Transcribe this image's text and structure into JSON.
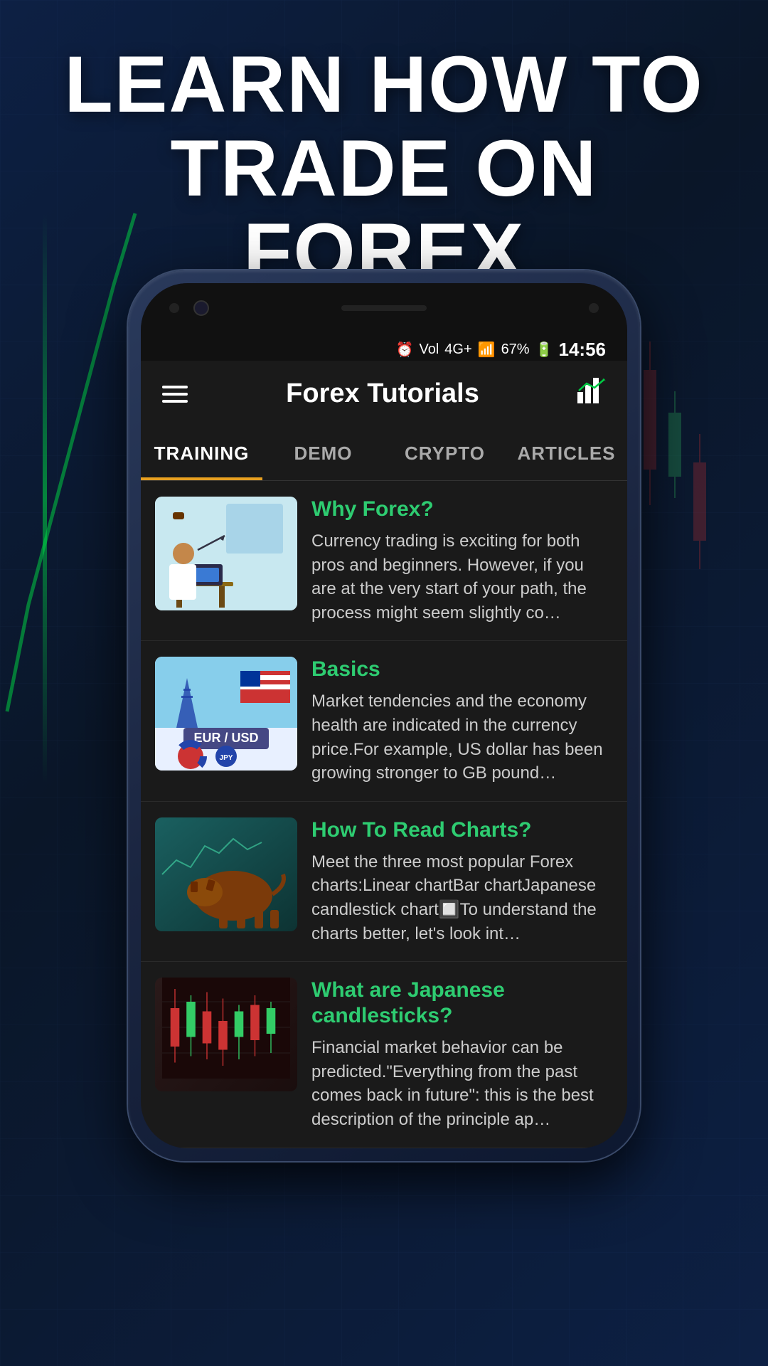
{
  "hero": {
    "title_line1": "LEARN HOW TO",
    "title_line2": "TRADE ON FOREX"
  },
  "status_bar": {
    "time": "14:56",
    "battery": "67%",
    "signal": "4G+",
    "vol": "Vol"
  },
  "app_header": {
    "title": "Forex Tutorials"
  },
  "tabs": [
    {
      "id": "training",
      "label": "TRAINING",
      "active": true
    },
    {
      "id": "demo",
      "label": "DEMO",
      "active": false
    },
    {
      "id": "crypto",
      "label": "CRYPTO",
      "active": false
    },
    {
      "id": "articles",
      "label": "ARTICLES",
      "active": false
    }
  ],
  "articles": [
    {
      "id": "why-forex",
      "title": "Why Forex?",
      "excerpt": "Currency trading is exciting for both pros and beginners. However, if you are at the very start of your path, the process might seem slightly co…"
    },
    {
      "id": "basics",
      "title": "Basics",
      "excerpt": "Market tendencies and the economy health are indicated in the currency price.For example, US dollar has been growing stronger to GB pound…"
    },
    {
      "id": "how-to-read-charts",
      "title": "How To Read Charts?",
      "excerpt": "Meet the three most popular Forex charts:Linear chartBar chartJapanese candlestick chart🔲To understand the charts better, let's look int…"
    },
    {
      "id": "japanese-candlesticks",
      "title": "What are Japanese candlesticks?",
      "excerpt": "Financial market behavior can be predicted.\"Everything from the past comes back in future\": this is the best description of the principle ap…"
    }
  ]
}
